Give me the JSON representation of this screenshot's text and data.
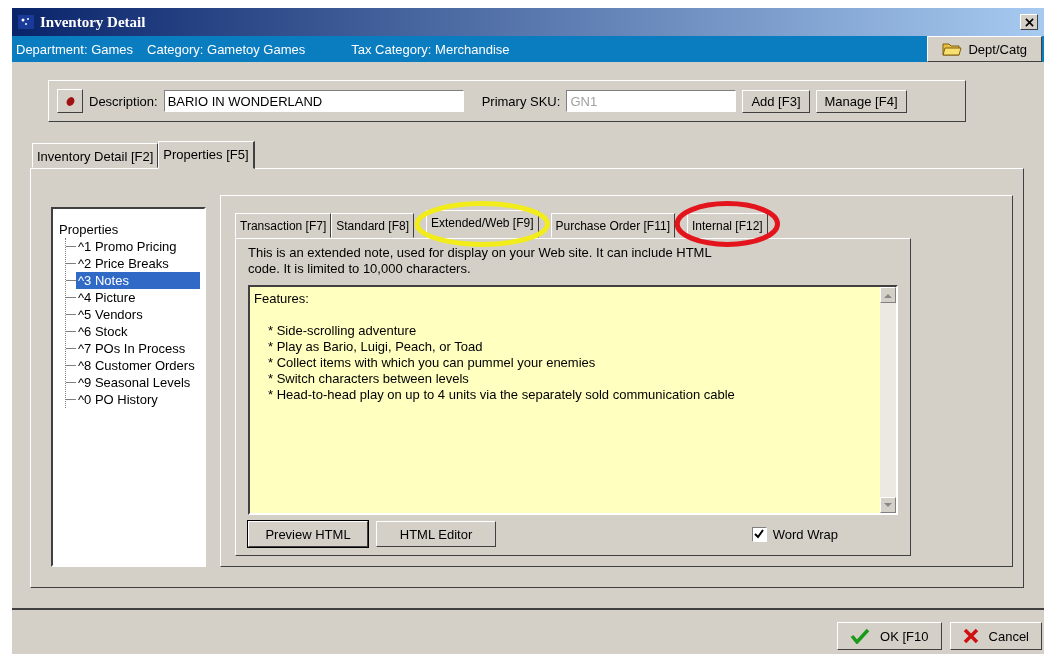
{
  "window": {
    "title": "Inventory Detail"
  },
  "info_bar": {
    "department": "Department: Games",
    "category": "Category: Gametoy Games",
    "tax_category": "Tax Category: Merchandise",
    "button": "Dept/Catg"
  },
  "description": {
    "label": "Description:",
    "value": "BARIO IN WONDERLAND",
    "sku_label": "Primary SKU:",
    "sku_value": "GN1",
    "buttons": [
      "Add [F3]",
      "Manage [F4]"
    ]
  },
  "main_tabs": [
    {
      "label": "Inventory Detail [F2]",
      "selected": false
    },
    {
      "label": "Properties [F5]",
      "selected": true
    }
  ],
  "tree": {
    "label": "Properties",
    "children": [
      {
        "label": "^1 Promo Pricing",
        "selected": false
      },
      {
        "label": "^2 Price Breaks",
        "selected": false
      },
      {
        "label": "^3 Notes",
        "selected": true
      },
      {
        "label": "^4 Picture",
        "selected": false
      },
      {
        "label": "^5 Vendors",
        "selected": false
      },
      {
        "label": "^6 Stock",
        "selected": false
      },
      {
        "label": "^7 POs In Process",
        "selected": false
      },
      {
        "label": "^8 Customer Orders",
        "selected": false
      },
      {
        "label": "^9 Seasonal Levels",
        "selected": false
      },
      {
        "label": "^0 PO History",
        "selected": false
      }
    ]
  },
  "notes_tabs": [
    {
      "label": "Transaction [F7]",
      "selected": false
    },
    {
      "label": "Standard [F8]",
      "selected": false
    },
    {
      "label": "Extended/Web [F9]",
      "selected": true,
      "circle": {
        "color": "#f2ec1a"
      }
    },
    {
      "label": "Purchase Order [F11]",
      "selected": false
    },
    {
      "label": "Internal [F12]",
      "selected": false,
      "circle": {
        "color": "#e3141b"
      }
    }
  ],
  "note_help": "This is an extended note, used for display on your Web site.  It can include HTML code.  It is limited to 10,000 characters.",
  "note": {
    "heading": "Features:",
    "bullets": [
      "* Side-scrolling adventure",
      "* Play as Bario, Luigi, Peach, or Toad",
      "* Collect items with which you can pummel your enemies",
      "* Switch characters between levels",
      "* Head-to-head play on up to 4 units via the separately sold communication cable"
    ]
  },
  "note_buttons": [
    "Preview HTML",
    "HTML Editor"
  ],
  "word_wrap": {
    "label": "Word Wrap",
    "checked": true
  },
  "footer_buttons": [
    {
      "kind": "ok",
      "label": "OK [F10"
    },
    {
      "kind": "cancel",
      "label": "Cancel"
    }
  ]
}
